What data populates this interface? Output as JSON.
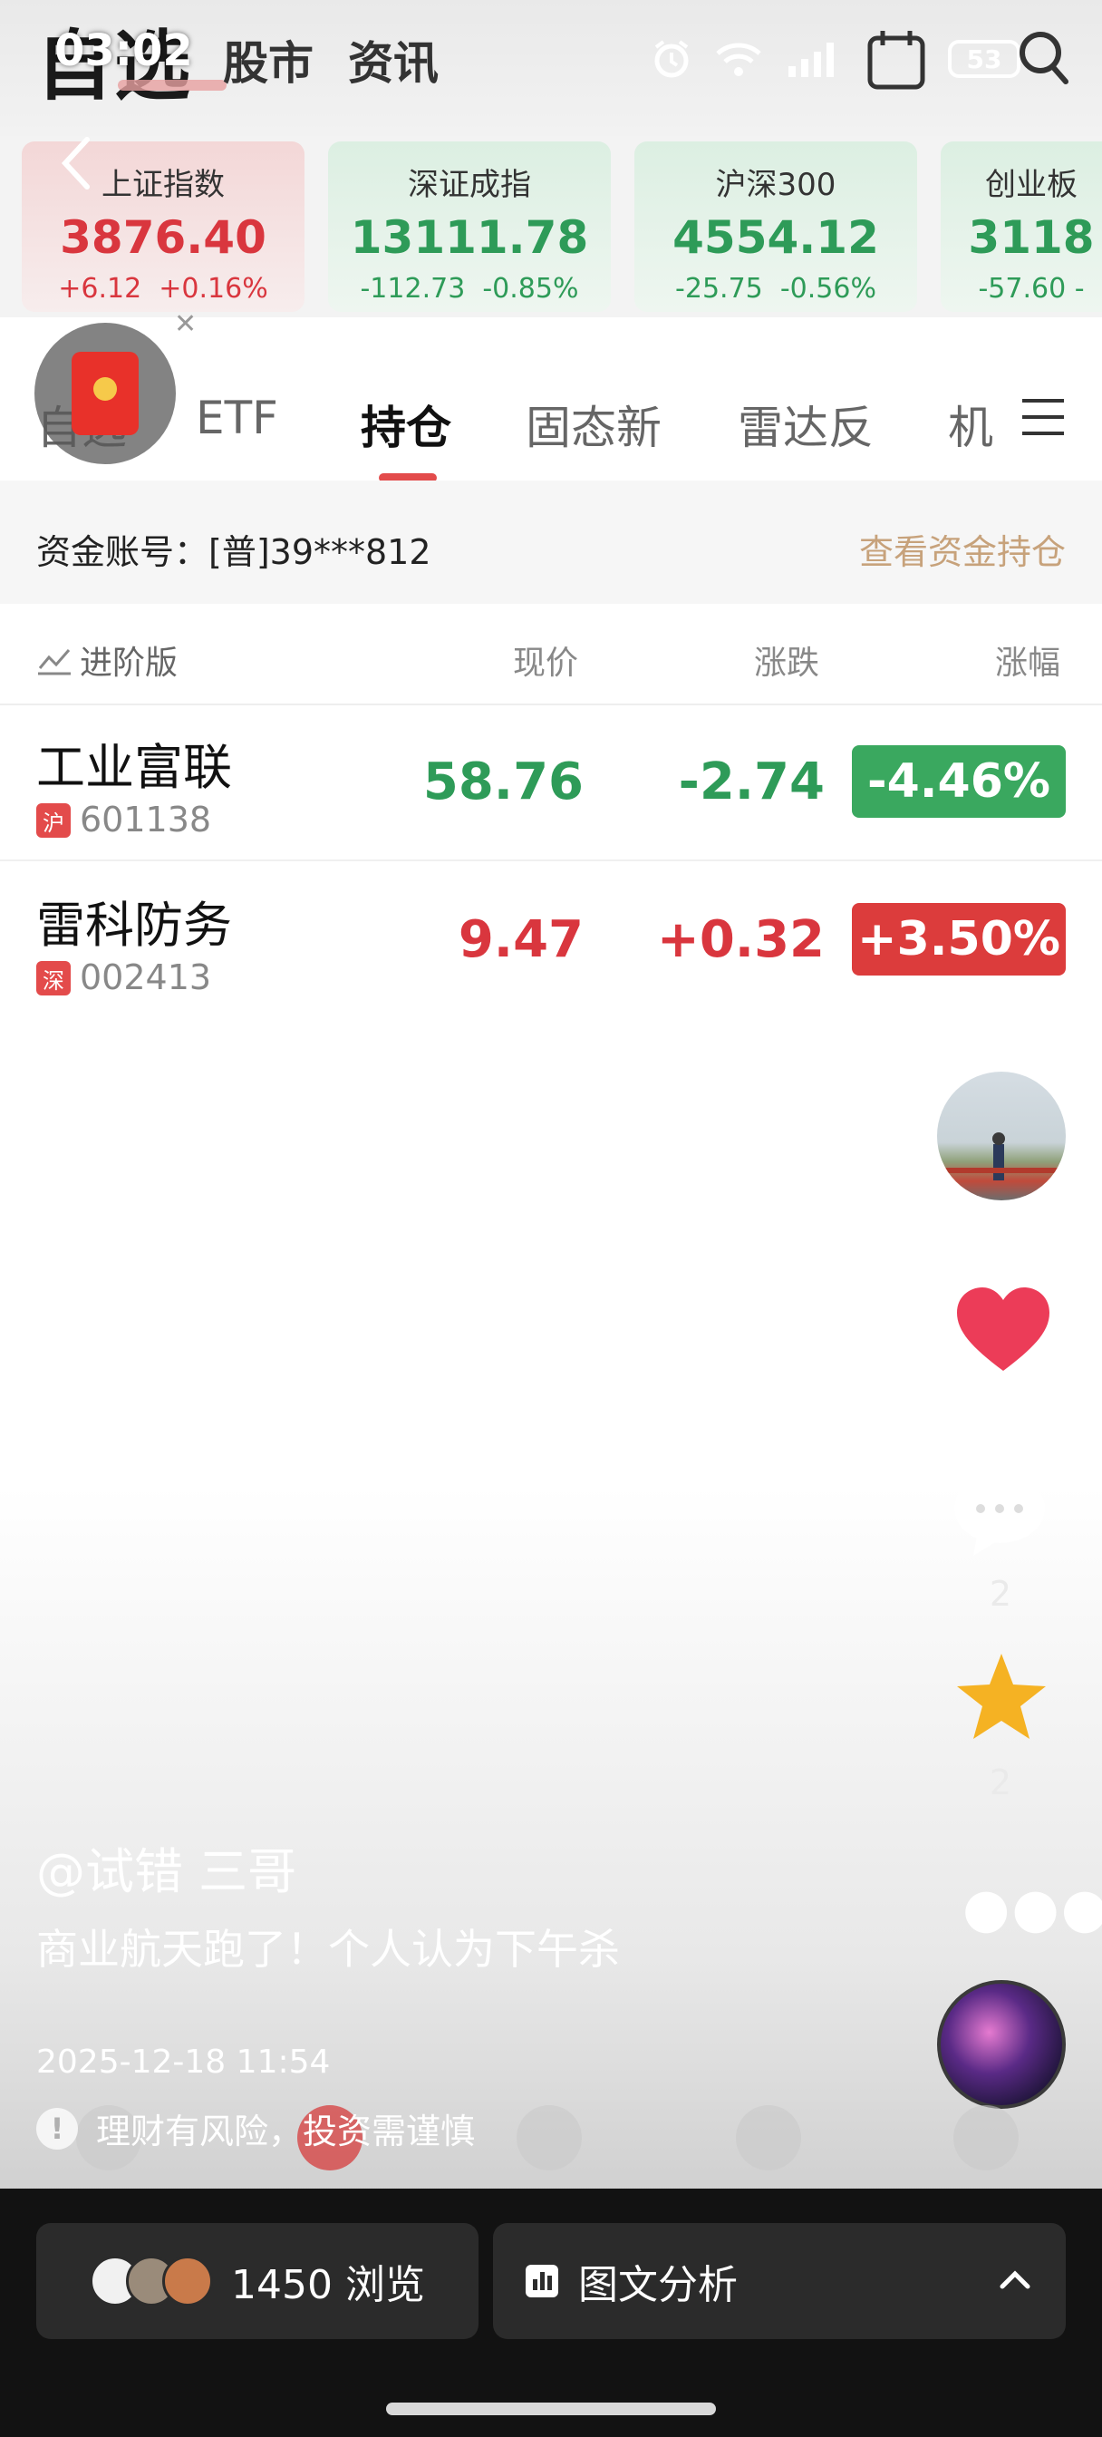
{
  "status_bar": {
    "time": "03:02",
    "battery": "53"
  },
  "top_nav": {
    "title": "自选",
    "links": [
      "股市",
      "资讯"
    ]
  },
  "index_cards": [
    {
      "name": "上证指数",
      "value": "3876.40",
      "change": "+6.12",
      "pct": "+0.16%",
      "trend": "up"
    },
    {
      "name": "深证成指",
      "value": "13111.78",
      "change": "-112.73",
      "pct": "-0.85%",
      "trend": "down"
    },
    {
      "name": "沪深300",
      "value": "4554.12",
      "change": "-25.75",
      "pct": "-0.56%",
      "trend": "down"
    },
    {
      "name": "创业板",
      "value": "3118",
      "change": "-57.60",
      "pct": "-",
      "trend": "down"
    }
  ],
  "tabs": [
    "自选",
    "ETF",
    "持仓",
    "固态新",
    "雷达反",
    "机"
  ],
  "active_tab": "持仓",
  "account": {
    "label": "资金账号：[普]39***812",
    "link": "查看资金持仓"
  },
  "list_header": {
    "advanced": "进阶版",
    "price": "现价",
    "change": "涨跌",
    "pct": "涨幅"
  },
  "holdings": [
    {
      "name": "工业富联",
      "market": "沪",
      "code": "601138",
      "price": "58.76",
      "change": "-2.74",
      "pct": "-4.46%",
      "trend": "down"
    },
    {
      "name": "雷科防务",
      "market": "深",
      "code": "002413",
      "price": "9.47",
      "change": "+0.32",
      "pct": "+3.50%",
      "trend": "up"
    }
  ],
  "side_actions": {
    "comment_count": "2",
    "favorite_count": "2"
  },
  "post": {
    "author": "@试错    三哥",
    "description": "商业航天跑了！个人认为下午杀",
    "date": "2025-12-18 11:54",
    "risk_notice": "理财有风险，投资需谨慎"
  },
  "bottom_bar": {
    "views": "1450 浏览",
    "analysis": "图文分析"
  },
  "colors": {
    "up": "#d9363e",
    "down": "#2e9b58",
    "accent_link": "#c7a27b",
    "tab_indicator": "#e34b4b"
  }
}
